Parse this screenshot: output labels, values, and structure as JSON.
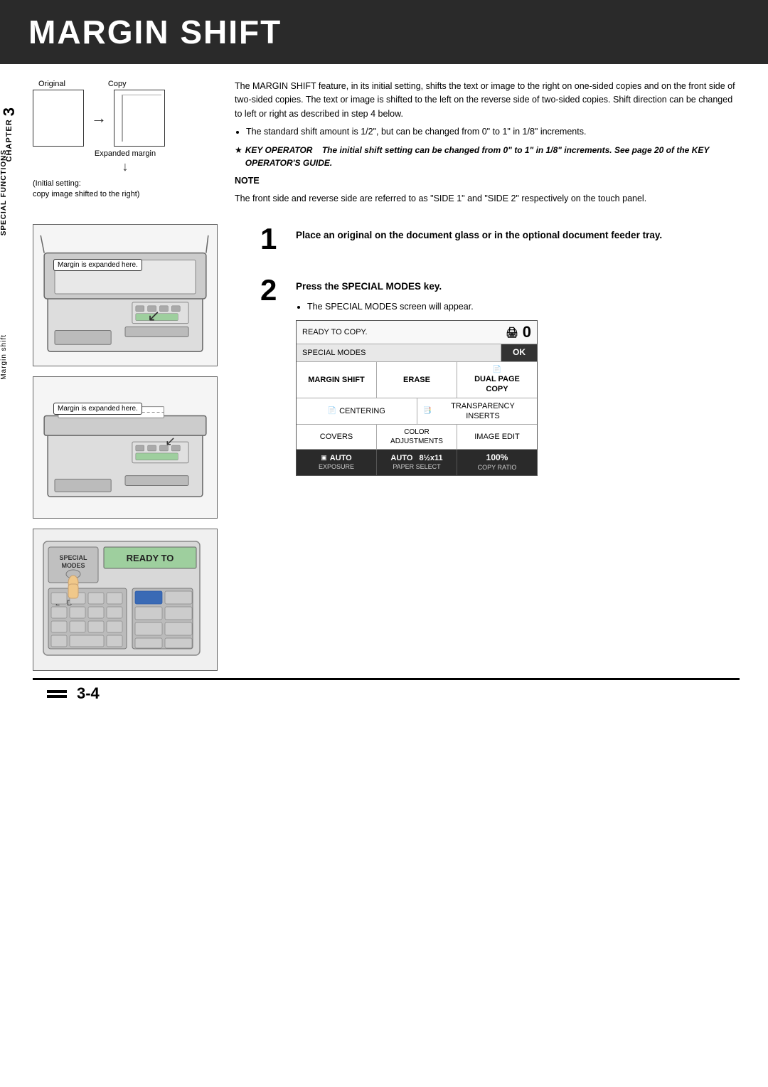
{
  "header": {
    "title": "MARGIN SHIFT",
    "bg_color": "#2a2a2a"
  },
  "sidebar": {
    "chapter_label": "CHAPTER",
    "chapter_number": "3",
    "functions_label": "SPECIAL FUNCTIONS",
    "margin_label": "Margin shift"
  },
  "top_section": {
    "original_label": "Original",
    "copy_label": "Copy",
    "expanded_margin_label": "Expanded margin",
    "initial_setting_text": "(Initial setting:\ncopy image shifted to the right)",
    "description": "The MARGIN SHIFT feature, in its initial setting, shifts the text or image to the right on one-sided copies and on the front side of two-sided copies. The text or image is shifted to the left on the reverse side of two-sided copies. Shift direction can be changed to left or right as described in step 4 below.",
    "bullet1": "The standard shift amount is 1/2\", but can be changed from 0\" to 1\" in 1/8\" increments.",
    "key_operator_star": "KEY OPERATOR",
    "key_operator_text": "The initial shift setting can be changed from 0\" to 1\" in 1/8\" increments. See page 20 of the KEY OPERATOR'S GUIDE.",
    "note_label": "NOTE",
    "note_text": "The front side and reverse side are referred to as \"SIDE 1\" and \"SIDE 2\" respectively on the touch panel."
  },
  "steps": [
    {
      "number": "1",
      "text": "Place an original on the document glass or in the optional document feeder tray.",
      "bullets": []
    },
    {
      "number": "2",
      "text": "Press the SPECIAL MODES key.",
      "bullets": [
        "The SPECIAL MODES screen will appear."
      ]
    }
  ],
  "margin_labels": {
    "label1": "Margin is expanded here.",
    "label2": "Margin is expanded here."
  },
  "panel_labels": {
    "special": "SPECIAL",
    "modes": "MODES",
    "ready_to": "READY TO",
    "num_2": "2-",
    "letter_d": "D"
  },
  "screen": {
    "ready_copy": "READY TO COPY.",
    "special_modes": "SPECIAL MODES",
    "ok": "OK",
    "margin_shift": "MARGIN SHIFT",
    "erase": "ERASE",
    "dual_page": "DUAL PAGE",
    "copy": "COPY",
    "centering": "CENTERING",
    "transparency_inserts": "TRANSPARENCY INSERTS",
    "covers": "COVERS",
    "color_adjustments": "COLOR\nADJUSTMENTS",
    "image_edit": "IMAGE EDIT",
    "auto_exposure": "AUTO",
    "exposure_label": "EXPOSURE",
    "auto_paper": "AUTO",
    "paper_select": "PAPER SELECT",
    "paper_size": "8½x11",
    "copy_ratio": "100%",
    "copy_ratio_label": "COPY RATIO"
  },
  "footer": {
    "page_number": "3-4"
  }
}
